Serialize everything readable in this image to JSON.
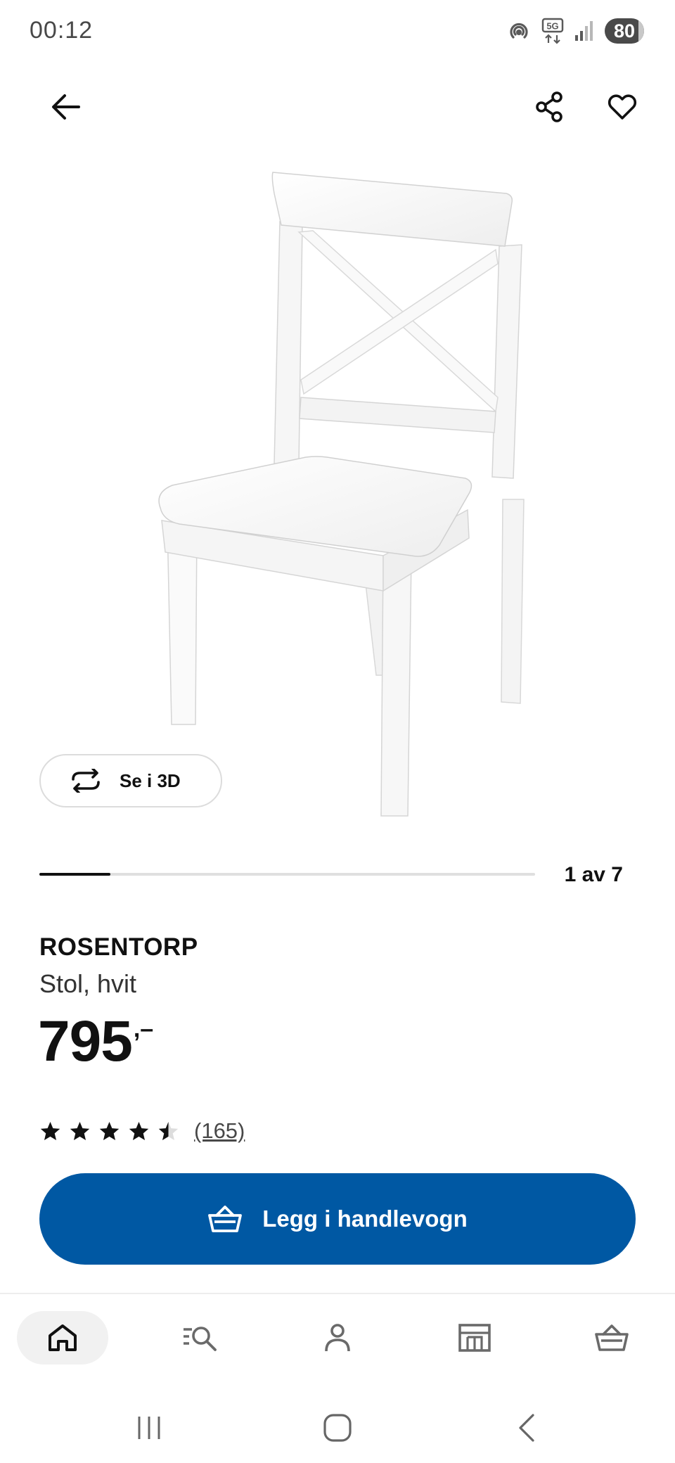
{
  "status_bar": {
    "time": "00:12",
    "battery": "80",
    "network": "5G"
  },
  "header": {
    "back_icon": "arrow-left-icon",
    "share_icon": "share-icon",
    "favorite_icon": "heart-icon"
  },
  "gallery": {
    "view_3d_label": "Se i 3D",
    "current_index": 1,
    "total": 7,
    "counter": "1 av 7"
  },
  "product": {
    "name": "ROSENTORP",
    "description": "Stol, hvit",
    "price_integer": "795",
    "price_decimal": ",–",
    "rating_value": 4.5,
    "rating_max": 5,
    "review_count": "(165)"
  },
  "actions": {
    "add_to_cart": "Legg i handlevogn"
  },
  "bottom_nav": [
    {
      "id": "home",
      "icon": "home-icon",
      "active": true
    },
    {
      "id": "search",
      "icon": "search-list-icon",
      "active": false
    },
    {
      "id": "profile",
      "icon": "user-icon",
      "active": false
    },
    {
      "id": "store",
      "icon": "store-icon",
      "active": false
    },
    {
      "id": "cart",
      "icon": "cart-icon",
      "active": false
    }
  ],
  "colors": {
    "primary": "#0058a3",
    "text": "#111111",
    "muted": "#484848",
    "track": "#dfdfdf"
  }
}
